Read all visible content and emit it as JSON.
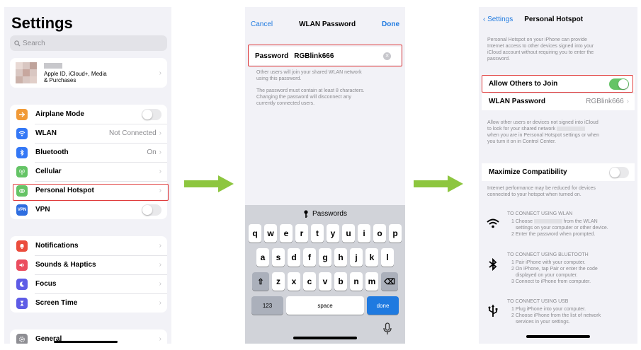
{
  "settings": {
    "title": "Settings",
    "search_placeholder": "Search",
    "apple_id_line1": "Apple ID, iCloud+, Media",
    "apple_id_line2": "& Purchases",
    "items": [
      {
        "label": "Airplane Mode",
        "value": "",
        "icon": "airplane-icon",
        "color": "#f19a37"
      },
      {
        "label": "WLAN",
        "value": "Not Connected",
        "icon": "wifi-icon",
        "color": "#3478f6"
      },
      {
        "label": "Bluetooth",
        "value": "On",
        "icon": "bluetooth-icon",
        "color": "#3478f6"
      },
      {
        "label": "Cellular",
        "value": "",
        "icon": "cellular-icon",
        "color": "#65c466"
      },
      {
        "label": "Personal Hotspot",
        "value": "",
        "icon": "hotspot-icon",
        "color": "#65c466"
      },
      {
        "label": "VPN",
        "value": "",
        "icon": "vpn-icon",
        "color": "#2f6ee0",
        "icon_text": "VPN"
      },
      {
        "label": "Notifications",
        "value": "",
        "icon": "notifications-icon",
        "color": "#eb4d3d"
      },
      {
        "label": "Sounds & Haptics",
        "value": "",
        "icon": "sounds-icon",
        "color": "#eb4d5f"
      },
      {
        "label": "Focus",
        "value": "",
        "icon": "focus-icon",
        "color": "#5e5ce6"
      },
      {
        "label": "Screen Time",
        "value": "",
        "icon": "screen-time-icon",
        "color": "#5e5ce6"
      },
      {
        "label": "General",
        "value": "",
        "icon": "gear-icon",
        "color": "#8e8e93"
      }
    ]
  },
  "wlan_password": {
    "cancel": "Cancel",
    "title": "WLAN Password",
    "done": "Done",
    "field_label": "Password",
    "field_value": "RGBlink666",
    "note1_line1": "Other users will join your shared WLAN network",
    "note1_line2": "using this password.",
    "note2_line1": "The password must contain at least 8 characters.",
    "note2_line2": "Changing the password will disconnect any",
    "note2_line3": "currently connected users.",
    "keyboard": {
      "passwords_label": "Passwords",
      "row1": [
        "q",
        "w",
        "e",
        "r",
        "t",
        "y",
        "u",
        "i",
        "o",
        "p"
      ],
      "row2": [
        "a",
        "s",
        "d",
        "f",
        "g",
        "h",
        "j",
        "k",
        "l"
      ],
      "row3": [
        "z",
        "x",
        "c",
        "v",
        "b",
        "n",
        "m"
      ],
      "key_123": "123",
      "key_space": "space",
      "key_done": "done"
    }
  },
  "hotspot": {
    "back": "Settings",
    "title": "Personal Hotspot",
    "intro_line1": "Personal Hotspot on your iPhone can provide",
    "intro_line2": "Internet access to other devices signed into your",
    "intro_line3": "iCloud account without requiring you to enter the",
    "intro_line4": "password.",
    "allow_label": "Allow Others to Join",
    "wlan_password_label": "WLAN Password",
    "wlan_password_value": "RGBlink666",
    "allow_note_line1": "Allow other users or devices not signed into iCloud",
    "allow_note_line2": "to look for your shared network",
    "allow_note_line3": "when you are in Personal Hotspot settings or when",
    "allow_note_line4": "you turn it on in Control Center.",
    "max_compat_label": "Maximize Compatibility",
    "compat_note_line1": "Internet performance may be reduced for devices",
    "compat_note_line2": "connected to your hotspot when turned on.",
    "wlan_head": "TO CONNECT USING WLAN",
    "wlan_step1a": "1 Choose",
    "wlan_step1b": "from the WLAN",
    "wlan_step1c": "settings on your computer or other device.",
    "wlan_step2": "2 Enter the password when prompted.",
    "bt_head": "TO CONNECT USING BLUETOOTH",
    "bt_step1": "1 Pair iPhone with your computer.",
    "bt_step2a": "2 On iPhone, tap Pair or enter the code",
    "bt_step2b": "displayed on your computer.",
    "bt_step3": "3 Connect to iPhone from computer.",
    "usb_head": "TO CONNECT USING USB",
    "usb_step1": "1 Plug iPhone into your computer.",
    "usb_step2a": "2 Choose iPhone from the list of network",
    "usb_step2b": "services in your settings."
  },
  "colors": {
    "accent": "#1f7ae0",
    "highlight": "#e03b3b",
    "arrow": "#8dc63f",
    "toggle_on": "#65c466"
  }
}
